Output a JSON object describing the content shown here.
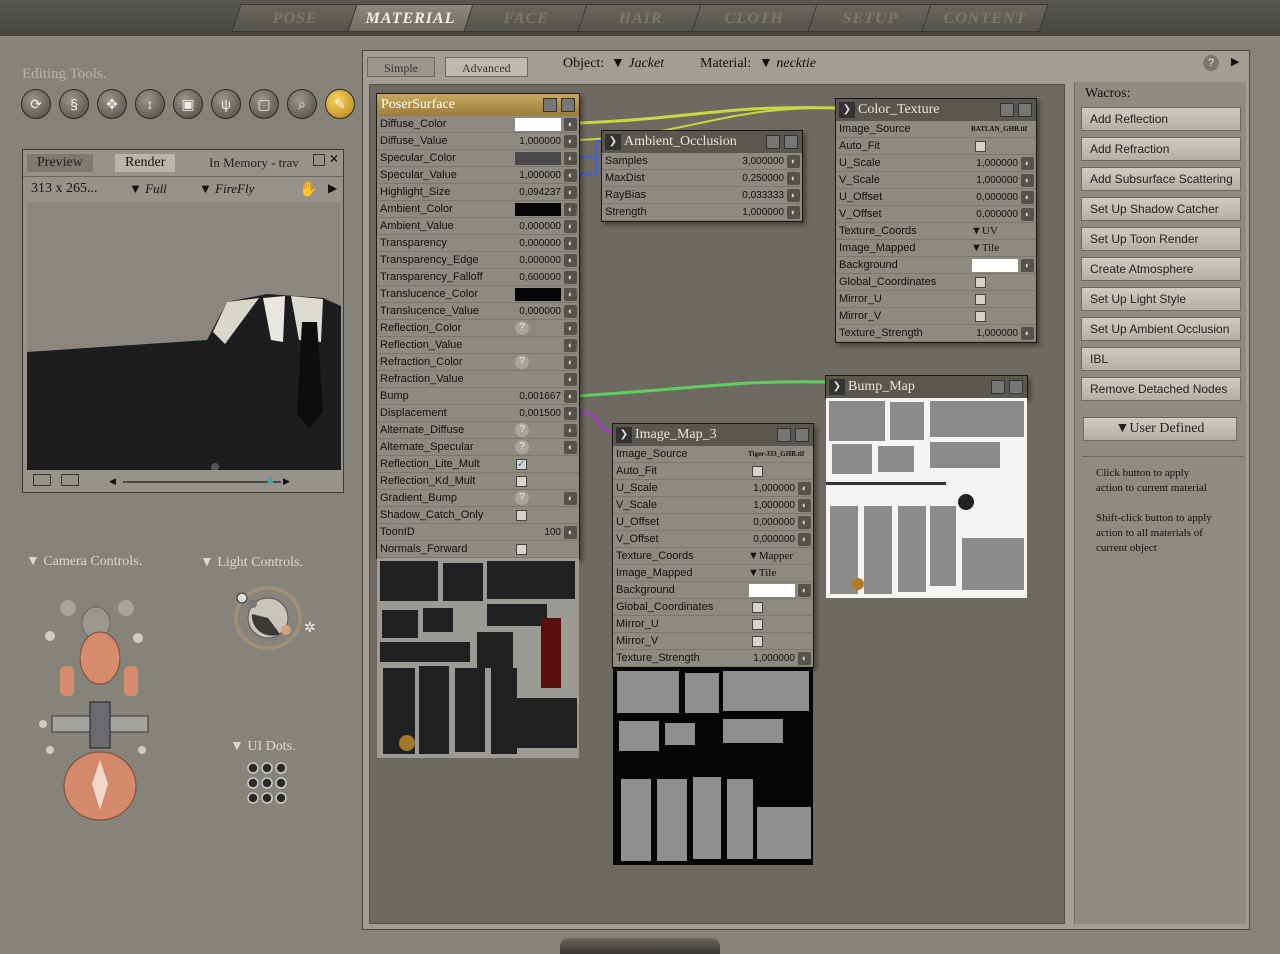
{
  "tabs": [
    "POSE",
    "MATERIAL",
    "FACE",
    "HAIR",
    "CLOTH",
    "SETUP",
    "CONTENT"
  ],
  "active_tab": "MATERIAL",
  "editing_tools": {
    "title": "Editing Tools.",
    "icons": [
      "rotate-icon",
      "twist-icon",
      "translate-icon",
      "translate-in-out-icon",
      "scale-icon",
      "taper-icon",
      "chain-break-icon",
      "zoom-icon",
      "color-picker-icon"
    ]
  },
  "preview": {
    "tab_preview": "Preview",
    "tab_render": "Render",
    "memory": "In Memory - trav",
    "size": "313 x 265...",
    "mode": "Full",
    "renderer": "FireFly"
  },
  "camera_controls": "Camera Controls.",
  "light_controls": "Light Controls.",
  "ui_dots": "UI Dots.",
  "material_tabs": {
    "simple": "Simple",
    "advanced": "Advanced"
  },
  "object": {
    "label": "Object:",
    "value": "Jacket"
  },
  "material": {
    "label": "Material:",
    "value": "necktie"
  },
  "poser_surface": {
    "title": "PoserSurface",
    "rows": [
      {
        "name": "Diffuse_Color",
        "value": "",
        "kind": "white"
      },
      {
        "name": "Diffuse_Value",
        "value": "1,000000",
        "kind": "num"
      },
      {
        "name": "Specular_Color",
        "value": "",
        "kind": "gray"
      },
      {
        "name": "Specular_Value",
        "value": "1,000000",
        "kind": "num"
      },
      {
        "name": "Highlight_Size",
        "value": "0,094237",
        "kind": "num"
      },
      {
        "name": "Ambient_Color",
        "value": "",
        "kind": "black"
      },
      {
        "name": "Ambient_Value",
        "value": "0,000000",
        "kind": "num"
      },
      {
        "name": "Transparency",
        "value": "0,000000",
        "kind": "num"
      },
      {
        "name": "Transparency_Edge",
        "value": "0,000000",
        "kind": "num"
      },
      {
        "name": "Transparency_Falloff",
        "value": "0,600000",
        "kind": "num"
      },
      {
        "name": "Translucence_Color",
        "value": "",
        "kind": "black"
      },
      {
        "name": "Translucence_Value",
        "value": "0,000000",
        "kind": "num"
      },
      {
        "name": "Reflection_Color",
        "value": "",
        "kind": "q"
      },
      {
        "name": "Reflection_Value",
        "value": "",
        "kind": "none"
      },
      {
        "name": "Refraction_Color",
        "value": "",
        "kind": "q"
      },
      {
        "name": "Refraction_Value",
        "value": "",
        "kind": "none"
      },
      {
        "name": "Bump",
        "value": "0,001667",
        "kind": "num"
      },
      {
        "name": "Displacement",
        "value": "0,001500",
        "kind": "num"
      },
      {
        "name": "Alternate_Diffuse",
        "value": "",
        "kind": "q"
      },
      {
        "name": "Alternate_Specular",
        "value": "",
        "kind": "q"
      },
      {
        "name": "Reflection_Lite_Mult",
        "value": "",
        "kind": "checked"
      },
      {
        "name": "Reflection_Kd_Mult",
        "value": "",
        "kind": "cb"
      },
      {
        "name": "Gradient_Bump",
        "value": "",
        "kind": "q"
      },
      {
        "name": "Shadow_Catch_Only",
        "value": "",
        "kind": "cb"
      },
      {
        "name": "ToonID",
        "value": "100",
        "kind": "num"
      },
      {
        "name": "Normals_Forward",
        "value": "",
        "kind": "cb"
      }
    ]
  },
  "ambient_occlusion": {
    "title": "Ambient_Occlusion",
    "rows": [
      {
        "name": "Samples",
        "value": "3,000000"
      },
      {
        "name": "MaxDist",
        "value": "0,250000"
      },
      {
        "name": "RayBias",
        "value": "0,033333"
      },
      {
        "name": "Strength",
        "value": "1,000000"
      }
    ]
  },
  "color_texture": {
    "title": "Color_Texture",
    "rows": [
      {
        "name": "Image_Source",
        "value": "BATLAN_GHB.tif",
        "kind": "src"
      },
      {
        "name": "Auto_Fit",
        "value": "",
        "kind": "cb"
      },
      {
        "name": "U_Scale",
        "value": "1,000000",
        "kind": "num"
      },
      {
        "name": "V_Scale",
        "value": "1,000000",
        "kind": "num"
      },
      {
        "name": "U_Offset",
        "value": "0,000000",
        "kind": "num"
      },
      {
        "name": "V_Offset",
        "value": "0,000000",
        "kind": "num"
      },
      {
        "name": "Texture_Coords",
        "value": "UV",
        "kind": "dd"
      },
      {
        "name": "Image_Mapped",
        "value": "Tile",
        "kind": "dd"
      },
      {
        "name": "Background",
        "value": "",
        "kind": "white"
      },
      {
        "name": "Global_Coordinates",
        "value": "",
        "kind": "cb"
      },
      {
        "name": "Mirror_U",
        "value": "",
        "kind": "cb"
      },
      {
        "name": "Mirror_V",
        "value": "",
        "kind": "cb"
      },
      {
        "name": "Texture_Strength",
        "value": "1,000000",
        "kind": "num"
      }
    ]
  },
  "image_map": {
    "title": "Image_Map_3",
    "rows": [
      {
        "name": "Image_Source",
        "value": "Tiger-333_GHB.tif",
        "kind": "src"
      },
      {
        "name": "Auto_Fit",
        "value": "",
        "kind": "cb"
      },
      {
        "name": "U_Scale",
        "value": "1,000000",
        "kind": "num"
      },
      {
        "name": "V_Scale",
        "value": "1,000000",
        "kind": "num"
      },
      {
        "name": "U_Offset",
        "value": "0,000000",
        "kind": "num"
      },
      {
        "name": "V_Offset",
        "value": "0,000000",
        "kind": "num"
      },
      {
        "name": "Texture_Coords",
        "value": "Mapper",
        "kind": "dd"
      },
      {
        "name": "Image_Mapped",
        "value": "Tile",
        "kind": "dd"
      },
      {
        "name": "Background",
        "value": "",
        "kind": "white"
      },
      {
        "name": "Global_Coordinates",
        "value": "",
        "kind": "cb"
      },
      {
        "name": "Mirror_U",
        "value": "",
        "kind": "cb"
      },
      {
        "name": "Mirror_V",
        "value": "",
        "kind": "cb"
      },
      {
        "name": "Texture_Strength",
        "value": "1,000000",
        "kind": "num"
      }
    ]
  },
  "bump_map": {
    "title": "Bump_Map"
  },
  "wacros": {
    "title": "Wacros:",
    "buttons": [
      "Add Reflection",
      "Add Refraction",
      "Add Subsurface Scattering",
      "Set Up Shadow Catcher",
      "Set Up Toon Render",
      "Create Atmosphere",
      "Set Up Light Style",
      "Set Up Ambient Occlusion",
      "IBL",
      "Remove Detached Nodes"
    ],
    "user_defined": "User Defined",
    "help1": "Click button to apply action to current material",
    "help2": "Shift-click button to apply action to all materials of current object"
  },
  "colors": {
    "accent": "#c8a85c",
    "link_green": "#5fcf5f",
    "link_yellow": "#c8d840",
    "link_purple": "#a040c0",
    "link_blue": "#4060e0"
  }
}
